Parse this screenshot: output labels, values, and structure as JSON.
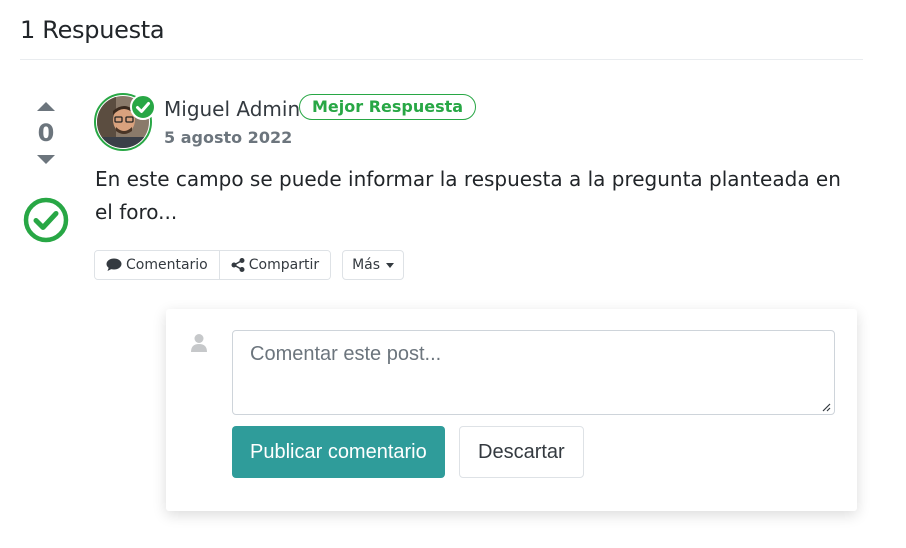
{
  "header": {
    "answers_count": "1 Respuesta"
  },
  "answer": {
    "votes": "0",
    "author": "Miguel Admin",
    "badge": "Mejor Respuesta",
    "date": "5 agosto 2022",
    "body": "En este campo se puede informar la respuesta a la pregunta planteada en el foro...",
    "actions": {
      "comment_label": "Comentario",
      "share_label": "Compartir",
      "more_label": "Más"
    }
  },
  "comment_form": {
    "placeholder": "Comentar este post...",
    "publish_label": "Publicar comentario",
    "discard_label": "Descartar"
  },
  "colors": {
    "accent_green": "#28a745",
    "primary_teal": "#2f9c9a",
    "muted": "#6c757d"
  },
  "icons": [
    "vote-up-icon",
    "vote-down-icon",
    "accepted-check-icon",
    "avatar",
    "verified-badge-icon",
    "comment-icon",
    "share-icon",
    "caret-down-icon",
    "user-icon"
  ]
}
